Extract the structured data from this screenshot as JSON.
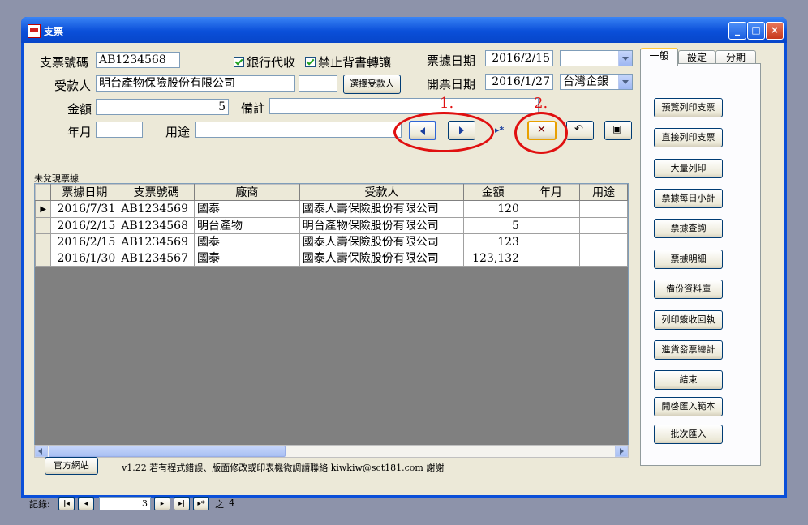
{
  "window": {
    "title": "支票"
  },
  "form": {
    "check_no_label": "支票號碼",
    "check_no_value": "AB1234568",
    "bank_proxy_label": "銀行代收",
    "no_endorse_label": "禁止背書轉讓",
    "bill_date_label": "票據日期",
    "bill_date_value": "2016/2/15",
    "payee_label": "受款人",
    "payee_value": "明台產物保險股份有限公司",
    "select_payee_button": "選擇受款人",
    "issue_date_label": "開票日期",
    "issue_date_value": "2016/1/27",
    "bank_value": "台灣企銀",
    "amount_label": "金額",
    "amount_value": "5",
    "note_label": "備註",
    "yearmonth_label": "年月",
    "purpose_label": "用途"
  },
  "annotations": {
    "first": "1.",
    "second": "2."
  },
  "grid": {
    "caption": "未兌現票據",
    "columns": [
      "票據日期",
      "支票號碼",
      "廠商",
      "受款人",
      "金額",
      "年月",
      "用途"
    ],
    "rows": [
      [
        "2016/7/31",
        "AB1234569",
        "國泰",
        "國泰人壽保險股份有限公司",
        "120",
        "",
        ""
      ],
      [
        "2016/2/15",
        "AB1234568",
        "明台產物",
        "明台產物保險股份有限公司",
        "5",
        "",
        ""
      ],
      [
        "2016/2/15",
        "AB1234569",
        "國泰",
        "國泰人壽保險股份有限公司",
        "123",
        "",
        ""
      ],
      [
        "2016/1/30",
        "AB1234567",
        "國泰",
        "國泰人壽保險股份有限公司",
        "123,132",
        "",
        ""
      ]
    ],
    "current_row": 0
  },
  "tabs": [
    "一般",
    "設定",
    "分期"
  ],
  "side_buttons": [
    "預覽列印支票",
    "直接列印支票",
    "大量列印",
    "票據每日小計",
    "票據查詢",
    "票據明細",
    "備份資料庫",
    "列印簽收回執",
    "進貨發票總計",
    "結束",
    "開啓匯入範本",
    "批次匯入"
  ],
  "footer": {
    "website_button": "官方網站",
    "version_text": "v1.22 若有程式錯誤、版面修改或印表機微調請聯絡 kiwkiw@sct181.com 謝謝"
  },
  "status": {
    "record_label": "記錄:",
    "current_record": "3",
    "of_label": "之",
    "total_records": "4"
  },
  "colors": {
    "titlebar": "#0a4fd9",
    "face": "#ece9d8",
    "annotation": "#e01010"
  }
}
